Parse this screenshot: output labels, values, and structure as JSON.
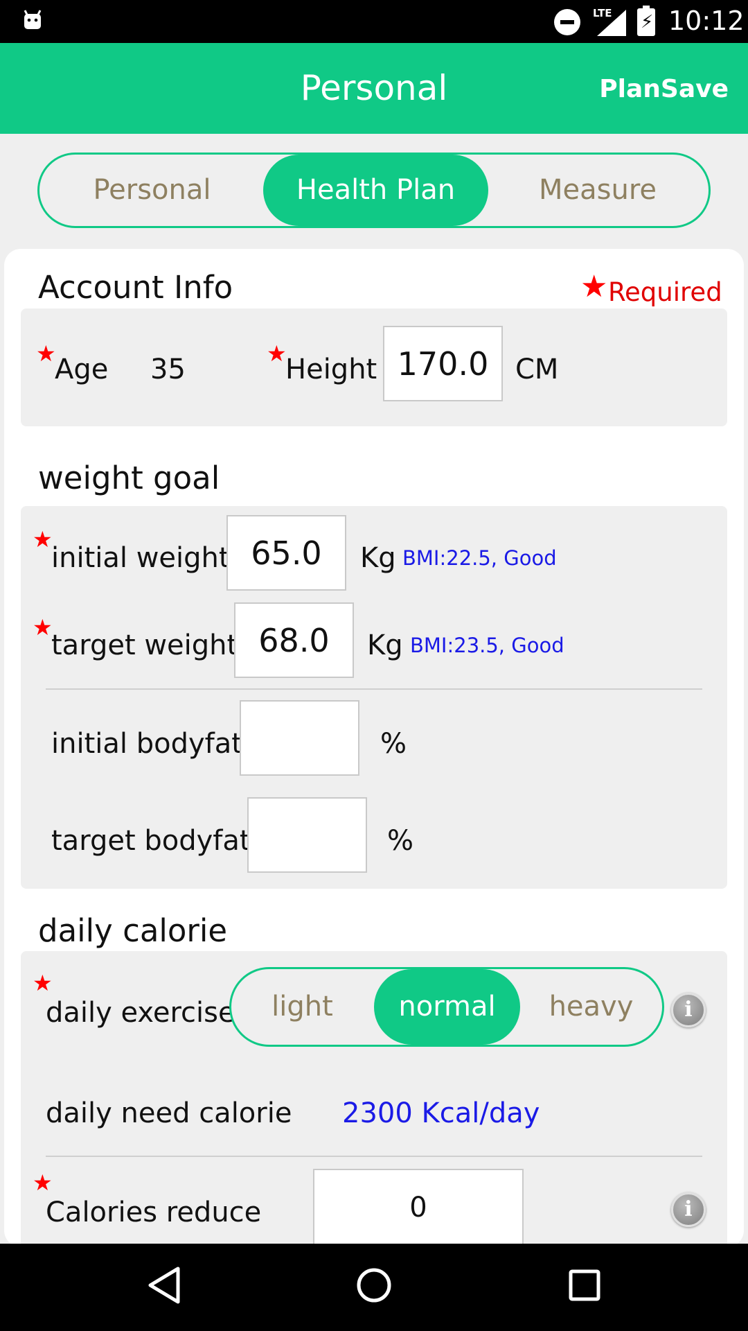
{
  "status_bar": {
    "time": "10:12",
    "network": "LTE",
    "icons": [
      "android-icon",
      "do-not-disturb-icon",
      "signal-icon",
      "battery-charging-icon"
    ]
  },
  "app_bar": {
    "title": "Personal",
    "action_label": "PlanSave"
  },
  "tabs": [
    {
      "label": "Personal",
      "active": false
    },
    {
      "label": "Health Plan",
      "active": true
    },
    {
      "label": "Measure",
      "active": false
    }
  ],
  "account_info": {
    "title": "Account Info",
    "required_label": "Required",
    "age_label": "Age",
    "age_value": "35",
    "height_label": "Height",
    "height_value": "170.0",
    "height_unit": "CM"
  },
  "weight_goal": {
    "title": "weight goal",
    "initial_weight_label": "initial weight",
    "initial_weight_value": "65.0",
    "initial_weight_unit": "Kg",
    "initial_bmi": "BMI:22.5, Good",
    "target_weight_label": "target weight",
    "target_weight_value": "68.0",
    "target_weight_unit": "Kg",
    "target_bmi": "BMI:23.5, Good",
    "initial_bodyfat_label": "initial bodyfat",
    "initial_bodyfat_value": "",
    "initial_bodyfat_unit": "%",
    "target_bodyfat_label": "target bodyfat",
    "target_bodyfat_value": "",
    "target_bodyfat_unit": "%"
  },
  "daily_calorie": {
    "title": "daily calorie",
    "exercise_label": "daily exercise",
    "exercise_options": [
      {
        "label": "light",
        "active": false
      },
      {
        "label": "normal",
        "active": true
      },
      {
        "label": "heavy",
        "active": false
      }
    ],
    "need_label": "daily need calorie",
    "need_value": "2300 Kcal/day",
    "reduce_label": "Calories reduce",
    "reduce_value": "0"
  },
  "colors": {
    "accent": "#10c986",
    "required": "#ff0000",
    "info_text": "#1a1ae6",
    "tab_inactive_text": "#8e8060"
  }
}
